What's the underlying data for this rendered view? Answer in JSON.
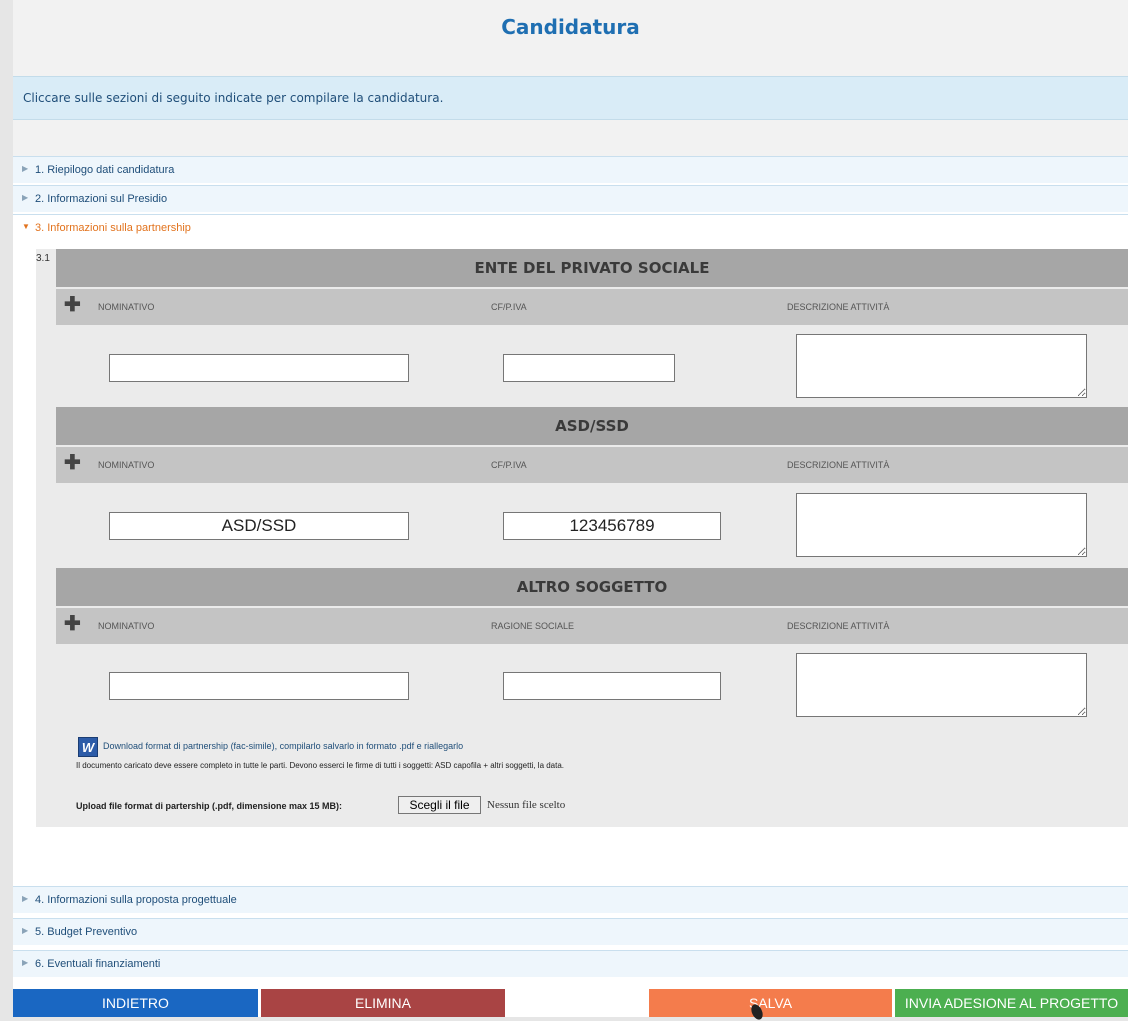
{
  "page_title": "Candidatura",
  "info_text": "Cliccare sulle sezioni di seguito indicate per compilare la candidatura.",
  "sections": [
    {
      "label": "1. Riepilogo dati candidatura"
    },
    {
      "label": "2. Informazioni sul Presidio"
    },
    {
      "label": "3. Informazioni sulla partnership"
    },
    {
      "label": "4. Informazioni sulla proposta progettuale"
    },
    {
      "label": "5. Budget Preventivo"
    },
    {
      "label": "6. Eventuali finanziamenti"
    }
  ],
  "subsection_number": "3.1",
  "groups": [
    {
      "title": "ENTE DEL PRIVATO SOCIALE",
      "col1": "NOMINATIVO",
      "col2": "CF/P.IVA",
      "col3": "DESCRIZIONE ATTIVITÀ",
      "nominativo_value": "",
      "cf_value": "",
      "descrizione_value": ""
    },
    {
      "title": "ASD/SSD",
      "col1": "NOMINATIVO",
      "col2": "CF/P.IVA",
      "col3": "DESCRIZIONE ATTIVITÀ",
      "nominativo_value": "ASD/SSD",
      "cf_value": "123456789",
      "descrizione_value": ""
    },
    {
      "title": "ALTRO SOGGETTO",
      "col1": "NOMINATIVO",
      "col2": "RAGIONE SOCIALE",
      "col3": "DESCRIZIONE ATTIVITÀ",
      "nominativo_value": "",
      "cf_value": "",
      "descrizione_value": ""
    }
  ],
  "add_icon": "plus-icon",
  "word_icon_letter": "W",
  "download_text": "Download format di partnership (fac-simile), compilarlo salvarlo in formato .pdf e riallegarlo",
  "document_note": "Il documento caricato deve essere completo in tutte le parti. Devono esserci le firme di tutti i soggetti: ASD capofila + altri soggetti, la data.",
  "upload_label": "Upload file format di partership (.pdf, dimensione max 15 MB):",
  "file_button_label": "Scegli il file",
  "file_status": "Nessun file scelto",
  "buttons": {
    "back": "INDIETRO",
    "delete": "ELIMINA",
    "save": "SALVA",
    "submit": "INVIA ADESIONE AL PROGETTO"
  },
  "colors": {
    "title": "#1f6fb2",
    "open_section": "#e2731e",
    "back": "#1a67c2",
    "delete": "#a94444",
    "save": "#f47c4c",
    "submit": "#4caf50"
  }
}
